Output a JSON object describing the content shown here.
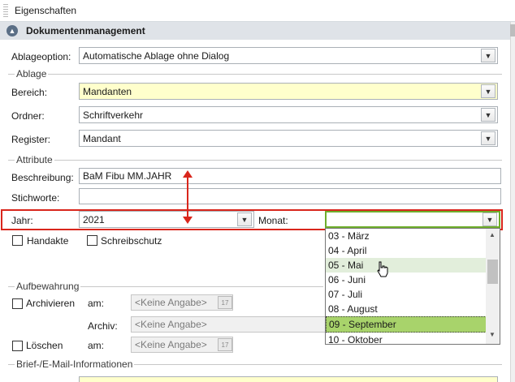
{
  "panel": {
    "title": "Eigenschaften"
  },
  "section": {
    "title": "Dokumentenmanagement",
    "collapse_icon": "chevron-up-icon"
  },
  "ablageoption": {
    "label": "Ablageoption:",
    "value": "Automatische Ablage ohne Dialog"
  },
  "ablage": {
    "group_title": "Ablage",
    "bereich": {
      "label": "Bereich:",
      "value": "Mandanten"
    },
    "ordner": {
      "label": "Ordner:",
      "value": "Schriftverkehr"
    },
    "register": {
      "label": "Register:",
      "value": "Mandant"
    }
  },
  "attribute": {
    "group_title": "Attribute",
    "beschreibung": {
      "label": "Beschreibung:",
      "value": "BaM Fibu MM.JAHR"
    },
    "stichworte": {
      "label": "Stichworte:",
      "value": ""
    },
    "jahr": {
      "label": "Jahr:",
      "value": "2021"
    },
    "monat": {
      "label": "Monat:",
      "value": ""
    },
    "handakte": {
      "label": "Handakte",
      "checked": false
    },
    "schreibschutz": {
      "label": "Schreibschutz",
      "checked": false
    }
  },
  "aufbewahrung": {
    "group_title": "Aufbewahrung",
    "archivieren": {
      "label": "Archivieren",
      "checked": false,
      "am_label": "am:",
      "am_value": "<Keine Angabe>"
    },
    "archiv": {
      "label": "Archiv:",
      "value": "<Keine Angabe>"
    },
    "loeschen": {
      "label": "Löschen",
      "checked": false,
      "am_label": "am:",
      "am_value": "<Keine Angabe>"
    }
  },
  "brief": {
    "group_title": "Brief-/E-Mail-Informationen"
  },
  "monat_dropdown": {
    "items": [
      {
        "label": "03 - März"
      },
      {
        "label": "04 - April"
      },
      {
        "label": "05 - Mai"
      },
      {
        "label": "06 - Juni"
      },
      {
        "label": "07 - Juli"
      },
      {
        "label": "08 - August"
      },
      {
        "label": "09 - September"
      },
      {
        "label": "10 - Oktober"
      }
    ],
    "hover_item": "05 - Mai",
    "selected_item": "09 - September"
  },
  "colors": {
    "highlight_red": "#d9261c",
    "selected_green": "#a8d36b",
    "required_yellow": "#ffffcc"
  },
  "calendar_icon_text": "17"
}
